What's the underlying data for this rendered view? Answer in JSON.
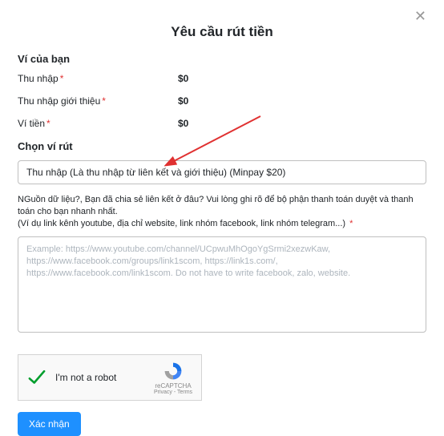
{
  "modal": {
    "title": "Yêu cầu rút tiền",
    "close_glyph": "✕"
  },
  "wallet": {
    "heading": "Ví của bạn",
    "rows": [
      {
        "label": "Thu nhập",
        "value": "$0"
      },
      {
        "label": "Thu nhập giới thiệu",
        "value": "$0"
      },
      {
        "label": "Ví tiền",
        "value": "$0"
      }
    ]
  },
  "withdraw": {
    "heading": "Chọn ví rút",
    "selected_option": "Thu nhập (Là thu nhập từ liên kết và giới thiệu) (Minpay $20)"
  },
  "source": {
    "label_line1": "NGuồn dữ liệu?, Bạn đã chia sẻ liên kết ở đâu? Vui lòng ghi rõ để bộ phận thanh toán duyệt và thanh toán cho bạn nhanh nhất.",
    "label_line2": "(Ví dụ link kênh youtube, địa chỉ website, link nhóm facebook, link nhóm telegram...)",
    "placeholder": "Example: https://www.youtube.com/channel/UCpwuMhOgoYgSrmi2xezwKaw, https://www.facebook.com/groups/link1scom, https://link1s.com/, https://www.facebook.com/link1scom. Do not have to write facebook, zalo, website."
  },
  "captcha": {
    "label": "I'm not a robot",
    "brand": "reCAPTCHA",
    "terms": "Privacy - Terms"
  },
  "submit": {
    "label": "Xác nhận"
  },
  "required_mark": "*"
}
